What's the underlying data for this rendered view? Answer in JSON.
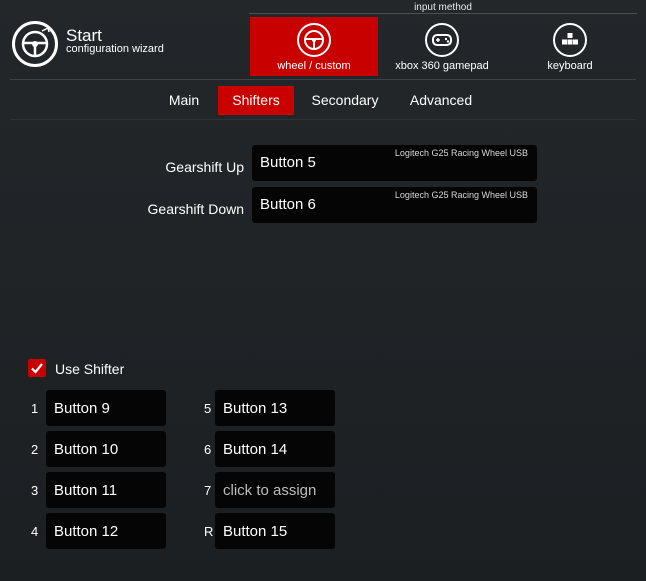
{
  "app": {
    "title": "Start",
    "subtitle": "configuration wizard"
  },
  "input_method": {
    "label": "input method",
    "options": [
      {
        "label": "wheel / custom",
        "icon": "steering-wheel-icon",
        "active": true
      },
      {
        "label": "xbox 360 gamepad",
        "icon": "gamepad-icon",
        "active": false
      },
      {
        "label": "keyboard",
        "icon": "keyboard-icon",
        "active": false
      }
    ]
  },
  "tabs": [
    {
      "label": "Main",
      "active": false
    },
    {
      "label": "Shifters",
      "active": true
    },
    {
      "label": "Secondary",
      "active": false
    },
    {
      "label": "Advanced",
      "active": false
    }
  ],
  "bindings": [
    {
      "label": "Gearshift Up",
      "value": "Button 5",
      "device": "Logitech G25 Racing Wheel USB"
    },
    {
      "label": "Gearshift Down",
      "value": "Button 6",
      "device": "Logitech G25 Racing Wheel USB"
    }
  ],
  "shifter": {
    "use_label": "Use Shifter",
    "checked": true,
    "gears": [
      {
        "num": "1",
        "value": "Button 9"
      },
      {
        "num": "2",
        "value": "Button 10"
      },
      {
        "num": "3",
        "value": "Button 11"
      },
      {
        "num": "4",
        "value": "Button 12"
      },
      {
        "num": "5",
        "value": "Button 13"
      },
      {
        "num": "6",
        "value": "Button 14"
      },
      {
        "num": "7",
        "value": "click to assign",
        "placeholder": true
      },
      {
        "num": "R",
        "value": "Button 15"
      }
    ]
  },
  "colors": {
    "accent": "#c80000",
    "background": "#202427",
    "field": "#050505"
  }
}
